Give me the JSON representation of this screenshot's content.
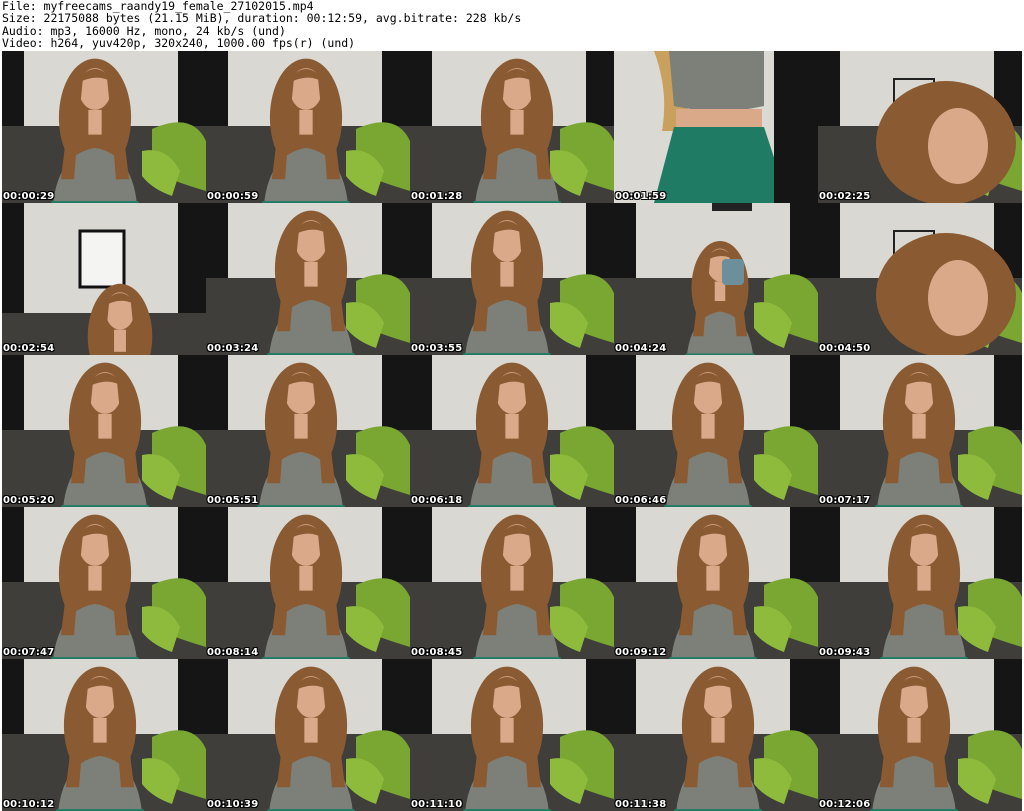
{
  "header": {
    "file_line": "File: myfreecams_raandy19_female_27102015.mp4",
    "size_line": "Size: 22175088 bytes (21.15 MiB), duration: 00:12:59, avg.bitrate: 228 kb/s",
    "audio_line": "Audio: mp3, 16000 Hz, mono, 24 kb/s (und)",
    "video_line": "Video: h264, yuv420p, 320x240, 1000.00 fps(r) (und)"
  },
  "thumbnails": [
    {
      "time": "00:00:29",
      "scene": "seated"
    },
    {
      "time": "00:00:59",
      "scene": "seated"
    },
    {
      "time": "00:01:28",
      "scene": "seated"
    },
    {
      "time": "00:01:59",
      "scene": "standing"
    },
    {
      "time": "00:02:25",
      "scene": "closeup"
    },
    {
      "time": "00:02:54",
      "scene": "frame"
    },
    {
      "time": "00:03:24",
      "scene": "seated"
    },
    {
      "time": "00:03:55",
      "scene": "seated"
    },
    {
      "time": "00:04:24",
      "scene": "mug"
    },
    {
      "time": "00:04:50",
      "scene": "closeup"
    },
    {
      "time": "00:05:20",
      "scene": "seated"
    },
    {
      "time": "00:05:51",
      "scene": "seated"
    },
    {
      "time": "00:06:18",
      "scene": "seated"
    },
    {
      "time": "00:06:46",
      "scene": "seated"
    },
    {
      "time": "00:07:17",
      "scene": "seated"
    },
    {
      "time": "00:07:47",
      "scene": "seated"
    },
    {
      "time": "00:08:14",
      "scene": "seated"
    },
    {
      "time": "00:08:45",
      "scene": "seated"
    },
    {
      "time": "00:09:12",
      "scene": "seated"
    },
    {
      "time": "00:09:43",
      "scene": "seated"
    },
    {
      "time": "00:10:12",
      "scene": "seated"
    },
    {
      "time": "00:10:39",
      "scene": "seated"
    },
    {
      "time": "00:11:10",
      "scene": "seated"
    },
    {
      "time": "00:11:38",
      "scene": "seated"
    },
    {
      "time": "00:12:06",
      "scene": "seated"
    }
  ],
  "colors": {
    "wall": "#d9d8d2",
    "curtain": "#151515",
    "sofa": "#3f3e3b",
    "pillow": "#7aa632",
    "hair": "#8a5a32",
    "skin": "#d9a98a",
    "top": "#7d8079",
    "skirt": "#1f7b63"
  }
}
